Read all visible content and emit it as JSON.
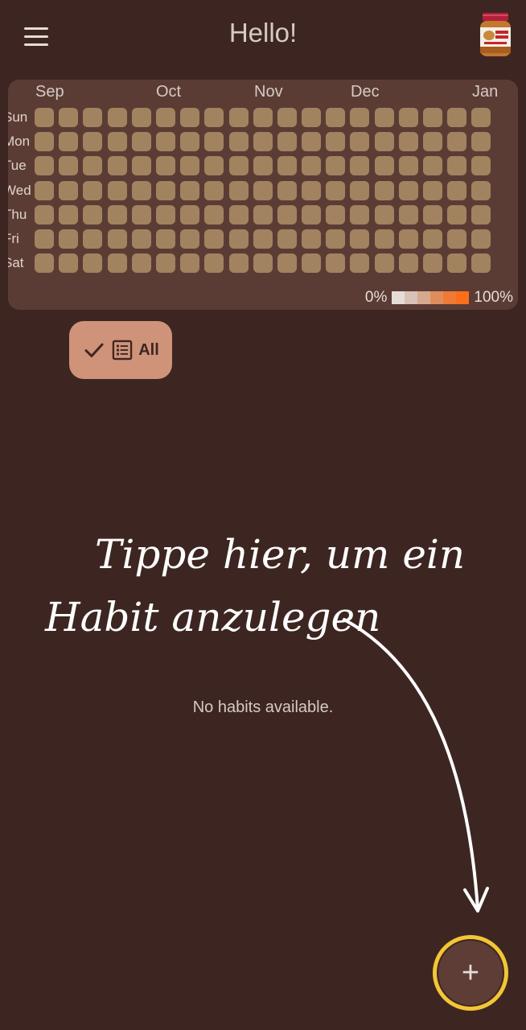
{
  "header": {
    "title": "Hello!",
    "menu_icon": "menu-icon",
    "avatar_icon": "peanut-butter-jar-icon"
  },
  "heatmap": {
    "months": [
      "Sep",
      "Oct",
      "Nov",
      "Dec",
      "Jan"
    ],
    "weekdays": [
      "Sun",
      "Mon",
      "Tue",
      "Wed",
      "Thu",
      "Fri",
      "Sat"
    ],
    "weeks": 19,
    "cell_color": "#a2835f",
    "legend": {
      "min_label": "0%",
      "max_label": "100%",
      "colors": [
        "#e6dcd7",
        "#d8c2b7",
        "#d6a98e",
        "#e08d5d",
        "#ee7a35",
        "#fb6f1b"
      ]
    }
  },
  "filter_chip": {
    "label": "All",
    "selected": true,
    "check_icon": "check-icon",
    "list_icon": "list-icon"
  },
  "hint": {
    "line1": "Tippe hier, um ein",
    "line2": "Habit anzulegen",
    "arrow_icon": "curved-arrow-icon"
  },
  "empty_state": "No habits available.",
  "fab": {
    "label": "+",
    "icon": "plus-icon",
    "highlight_color": "#f3c634"
  }
}
